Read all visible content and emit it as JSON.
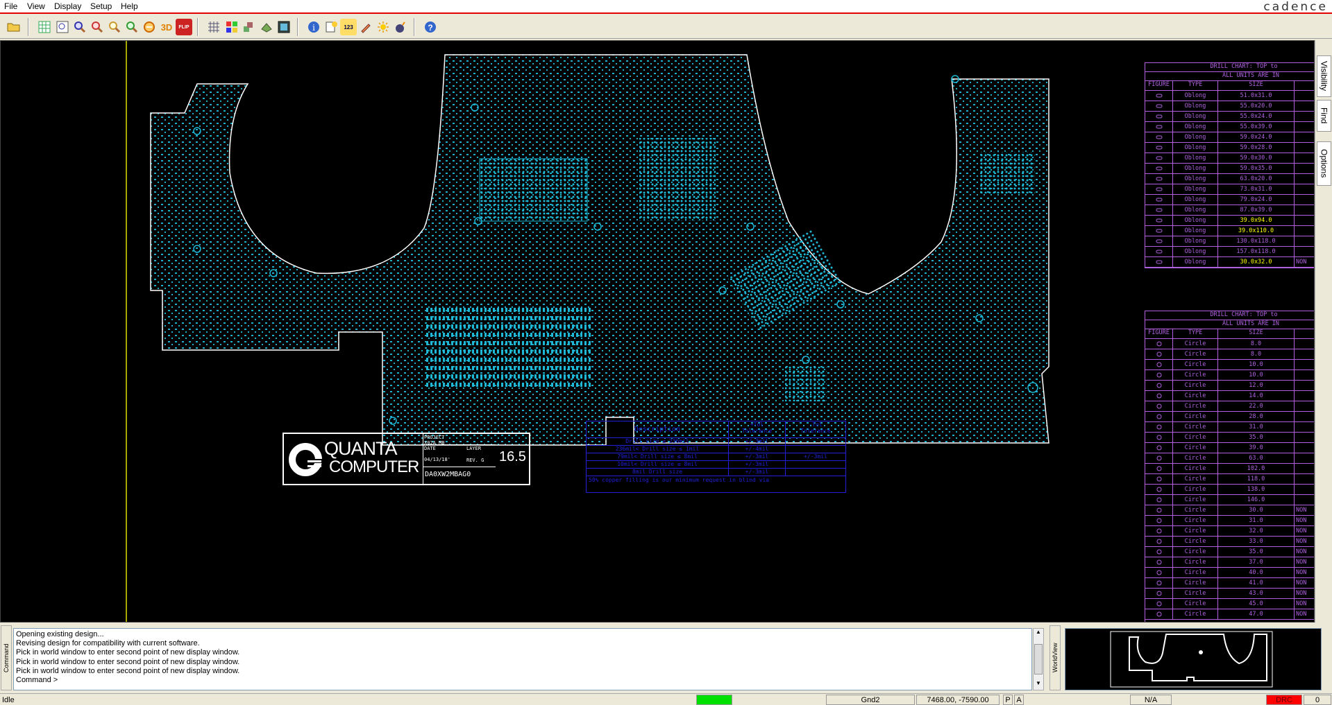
{
  "menu": {
    "items": [
      "File",
      "View",
      "Display",
      "Setup",
      "Help"
    ],
    "brand": "cadence"
  },
  "toolbar": {
    "icons": [
      "open-folder-icon",
      "grid-icon",
      "zoom-fit-icon",
      "zoom-points-icon",
      "zoom-in-icon",
      "zoom-out-icon",
      "zoom-world-icon",
      "zoom-previous-icon",
      "3d-view-icon",
      "flip-icon",
      "grid-toggle-icon",
      "color-icon",
      "layer-icon",
      "shadow-icon",
      "display-icon",
      "info-icon",
      "properties-icon",
      "measure-icon",
      "highlight-icon",
      "dehighlight-icon",
      "bomb-icon",
      "help-icon"
    ],
    "labels": {
      "3d": "3D",
      "flip": "FLIP",
      "measure": "123"
    }
  },
  "sidetabs": [
    "Visibility",
    "Find",
    "Options"
  ],
  "titleblock": {
    "company_line1": "QUANTA",
    "company_line2": "COMPUTER",
    "project_label": "PROJECT",
    "project_value": "X02A MB",
    "date_label": "DATE",
    "date_value": "04/13/18'",
    "layer_label": "LAYER",
    "rev": "REV. G",
    "board": "DA0XW2MBAG0",
    "version": "16.5"
  },
  "tolerance": {
    "headers": [
      "Description",
      "+Tol\nTolerance",
      "-Tol\nTolerance"
    ],
    "rows": [
      [
        "Drill size ≤ 236mil",
        "+/-3mil",
        ""
      ],
      [
        "236mil< Drill size ≤ 1mil",
        "+/-4mil",
        ""
      ],
      [
        "79mil< Drill size ≤ 8mil",
        "+/-3mil",
        "+/-3mil"
      ],
      [
        "10mil< Drill size ≤ 8mil",
        "+/-3mil",
        ""
      ],
      [
        "8mil Drill size",
        "+/-3mil",
        ""
      ]
    ],
    "footer": "50% copper filling is our minimum request in blind via"
  },
  "drill_chart_1": {
    "title": "DRILL CHART: TOP to",
    "subtitle": "ALL UNITS ARE IN",
    "headers": [
      "FIGURE",
      "TYPE",
      "SIZE"
    ],
    "rows": [
      [
        "Oblong",
        "51.0x31.0"
      ],
      [
        "Oblong",
        "55.0x20.0"
      ],
      [
        "Oblong",
        "55.0x24.0"
      ],
      [
        "Oblong",
        "55.0x39.0"
      ],
      [
        "Oblong",
        "59.0x24.0"
      ],
      [
        "Oblong",
        "59.0x28.0"
      ],
      [
        "Oblong",
        "59.0x30.0"
      ],
      [
        "Oblong",
        "59.0x35.0"
      ],
      [
        "Oblong",
        "63.0x20.0"
      ],
      [
        "Oblong",
        "73.0x31.0"
      ],
      [
        "Oblong",
        "79.0x24.0"
      ],
      [
        "Oblong",
        "87.0x39.0"
      ],
      [
        "Oblong",
        "39.0x94.0"
      ],
      [
        "Oblong",
        "39.0x110.0"
      ],
      [
        "Oblong",
        "130.0x118.0"
      ],
      [
        "Oblong",
        "157.0x118.0"
      ],
      [
        "Oblong",
        "30.0x32.0"
      ]
    ],
    "highlight_rows": [
      12,
      13,
      16
    ],
    "suffix": "NON"
  },
  "drill_chart_2": {
    "title": "DRILL CHART: TOP to",
    "subtitle": "ALL UNITS ARE IN",
    "headers": [
      "FIGURE",
      "TYPE",
      "SIZE"
    ],
    "rows": [
      [
        "Circle",
        "8.0"
      ],
      [
        "Circle",
        "8.0"
      ],
      [
        "Circle",
        "10.0"
      ],
      [
        "Circle",
        "10.0"
      ],
      [
        "Circle",
        "12.0"
      ],
      [
        "Circle",
        "14.0"
      ],
      [
        "Circle",
        "22.0"
      ],
      [
        "Circle",
        "28.0"
      ],
      [
        "Circle",
        "31.0"
      ],
      [
        "Circle",
        "35.0"
      ],
      [
        "Circle",
        "39.0"
      ],
      [
        "Circle",
        "63.0"
      ],
      [
        "Circle",
        "102.0"
      ],
      [
        "Circle",
        "118.0"
      ],
      [
        "Circle",
        "138.0"
      ],
      [
        "Circle",
        "146.0"
      ],
      [
        "Circle",
        "30.0"
      ],
      [
        "Circle",
        "31.0"
      ],
      [
        "Circle",
        "32.0"
      ],
      [
        "Circle",
        "33.0"
      ],
      [
        "Circle",
        "35.0"
      ],
      [
        "Circle",
        "37.0"
      ],
      [
        "Circle",
        "40.0"
      ],
      [
        "Circle",
        "41.0"
      ],
      [
        "Circle",
        "43.0"
      ],
      [
        "Circle",
        "45.0"
      ],
      [
        "Circle",
        "47.0"
      ]
    ],
    "non_from": 16,
    "suffix": "NON"
  },
  "console": {
    "label": "Command",
    "lines": [
      "Opening existing design...",
      "Revising design for compatibility with current software.",
      "Pick in world window to enter second point of new display window.",
      "Pick in world window to enter second point of new display window.",
      "Pick in world window to enter second point of new display window."
    ],
    "prompt": "Command >"
  },
  "worldview": {
    "label": "WorldView"
  },
  "status": {
    "state": "Idle",
    "layer": "Gnd2",
    "coords": "7468.00, -7590.00",
    "p": "P",
    "a": "A",
    "na": "N/A",
    "drc": "DRC",
    "count": "0"
  },
  "colors": {
    "trace": "#1fb8d6",
    "outline": "#ffffff",
    "chart": "#b060e0",
    "tolerance": "#2020d8",
    "highlight": "#ffff00",
    "drc": "#ff0000",
    "status_ok": "#00e000"
  }
}
